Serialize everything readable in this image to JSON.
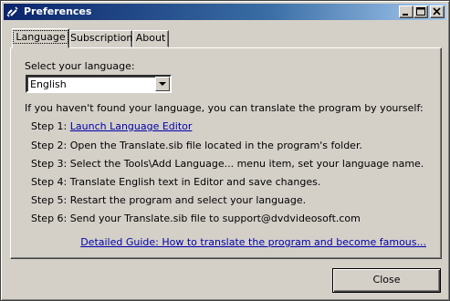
{
  "window": {
    "title": "Preferences"
  },
  "tabs": [
    {
      "label": "Language"
    },
    {
      "label": "Subscription"
    },
    {
      "label": "About"
    }
  ],
  "language_tab": {
    "select_label": "Select your language:",
    "selected_language": "English",
    "intro": "If you haven't found your language, you can translate the program by yourself:",
    "step1_prefix": "Step 1: ",
    "step1_link": "Launch Language Editor",
    "step2": "Step 2: Open the Translate.sib file located in the program's folder.",
    "step3": "Step 3: Select the Tools\\Add Language... menu item, set your language name.",
    "step4": "Step 4: Translate English text in Editor and save changes.",
    "step5": "Step 5: Restart the program and select your language.",
    "step6": "Step 6: Send your Translate.sib file to support@dvdvideosoft.com",
    "guide_link": "Detailed Guide: How to translate the program and become famous..."
  },
  "footer": {
    "close_label": "Close"
  },
  "icons": {
    "app": "link-icon",
    "minimize": "minimize-icon",
    "maximize": "maximize-icon",
    "close": "close-icon",
    "dropdown": "chevron-down-icon"
  },
  "colors": {
    "titlebar_start": "#0a246a",
    "titlebar_end": "#a6caf0",
    "face": "#d4d0c8",
    "link": "#0000aa"
  }
}
